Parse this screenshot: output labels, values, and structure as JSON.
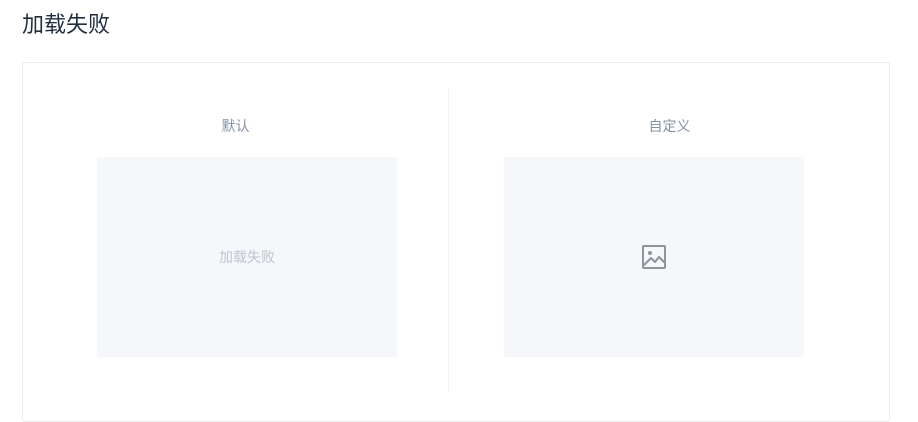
{
  "page": {
    "title": "加载失败"
  },
  "demos": [
    {
      "label": "默认",
      "error_text": "加载失败"
    },
    {
      "label": "自定义",
      "error_icon": "picture-outline-icon"
    }
  ],
  "colors": {
    "placeholder_bg": "#f5f7fa",
    "label_text": "#8492a6",
    "error_text": "#c0c4cc",
    "icon": "#909399"
  }
}
